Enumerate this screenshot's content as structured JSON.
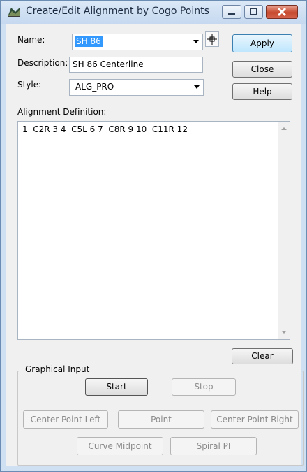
{
  "window": {
    "title": "Create/Edit Alignment by Cogo Points"
  },
  "form": {
    "name_label": "Name:",
    "name_value": "SH 86",
    "description_label": "Description:",
    "description_value": "SH 86 Centerline",
    "style_label": "Style:",
    "style_value": "ALG_PRO",
    "alignment_definition_label": "Alignment Definition:",
    "alignment_definition_value": "1  C2R 3 4  C5L 6 7  C8R 9 10  C11R 12"
  },
  "buttons": {
    "apply": "Apply",
    "close": "Close",
    "help": "Help",
    "clear": "Clear"
  },
  "graphical_input": {
    "title": "Graphical Input",
    "start": "Start",
    "stop": "Stop",
    "center_point_left": "Center Point Left",
    "point": "Point",
    "center_point_right": "Center Point Right",
    "curve_midpoint": "Curve Midpoint",
    "spiral_pi": "Spiral PI"
  },
  "colors": {
    "title_bar": "#c4d8ef",
    "dialog_bg": "#f0f0f0",
    "selection": "#3399ff",
    "close_button": "#c74a2e"
  },
  "icons": {
    "app": "alignment-app-icon",
    "locate": "crosshair-icon"
  }
}
